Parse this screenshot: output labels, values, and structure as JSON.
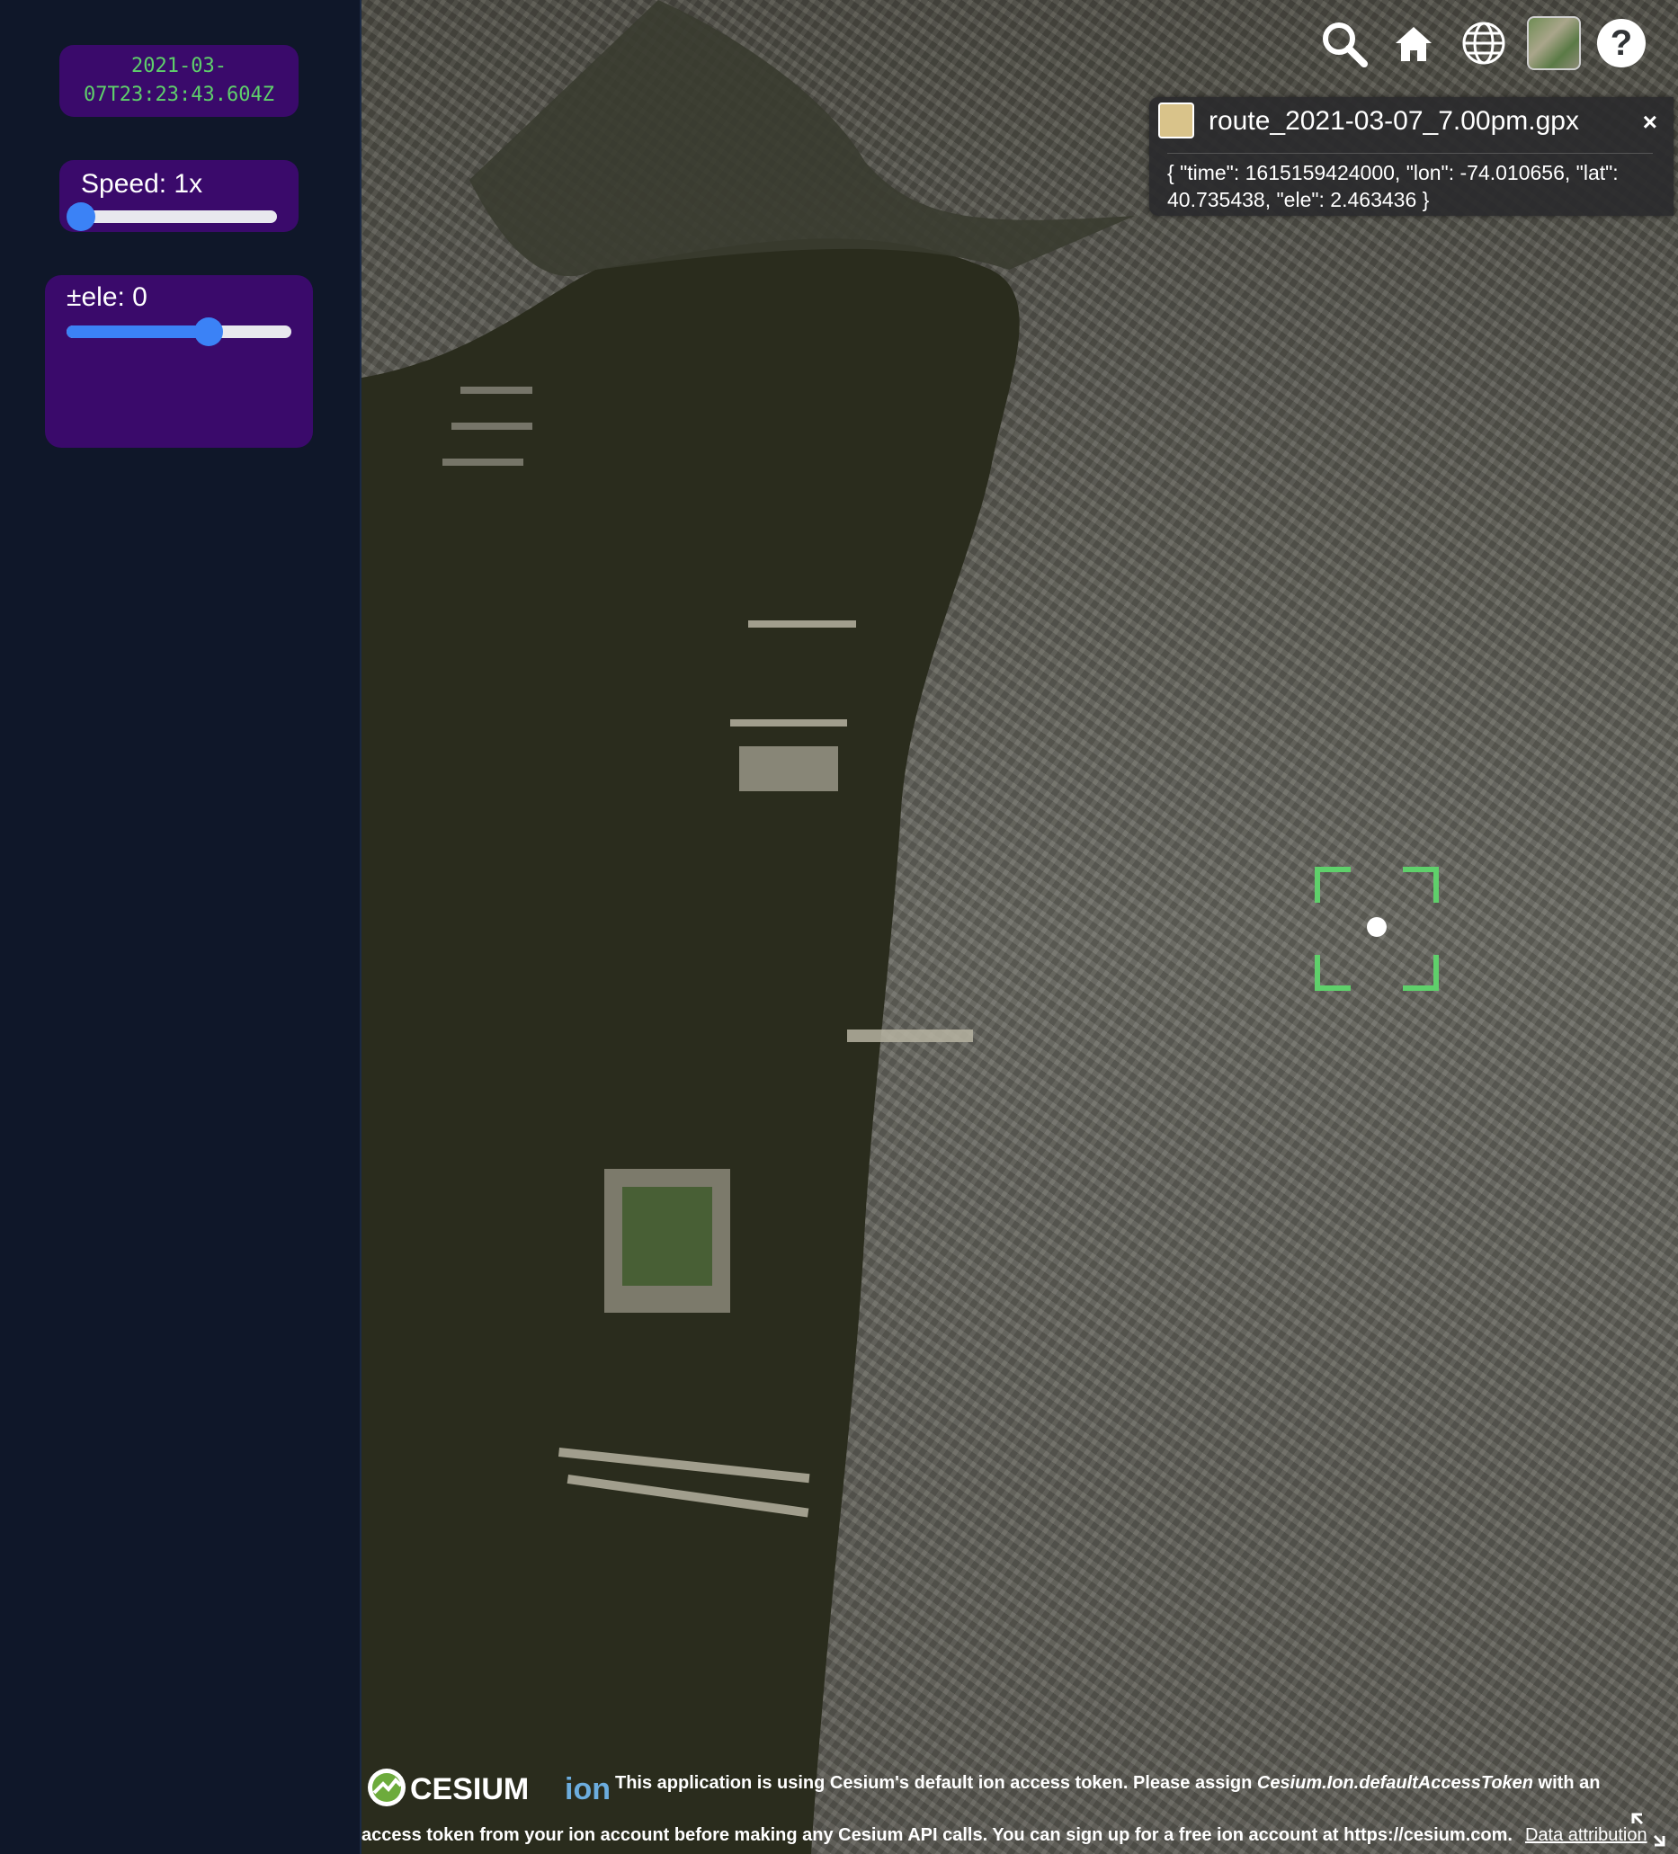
{
  "sidebar": {
    "timestamp": "2021-03-\n07T23:23:43.604Z",
    "speed": {
      "label": "Speed: 1x",
      "value": 0.0
    },
    "elevation": {
      "label": "±ele: 0",
      "value": 0.63
    }
  },
  "toolbar": {
    "search": "search-icon",
    "home": "home-icon",
    "scene_mode": "globe-icon",
    "base_layer": "imagery-layer-icon",
    "help": "?"
  },
  "infobox": {
    "title": "route_2021-03-07_7.00pm.gpx",
    "close": "×",
    "body": "{ \"time\": 1615159424000, \"lon\": -74.010656, \"lat\": 40.735438, \"ele\": 2.463436 }"
  },
  "credits": {
    "logo_text": "CESIUM",
    "logo_suffix": "ion",
    "line1_a": "This application is using Cesium's default ion access token. Please assign ",
    "line1_em": "Cesium.Ion.defaultAccessToken",
    "line1_b": " with an",
    "line2": "access token from your ion account before making any Cesium API calls. You can sign up for a free ion account at https://cesium.com.",
    "data_attribution": "Data attribution"
  },
  "colors": {
    "card_bg": "#3a0a6b",
    "slider_accent": "#3b82f6",
    "timestamp_text": "#5fd06b",
    "selection_green": "#5fd06b"
  }
}
